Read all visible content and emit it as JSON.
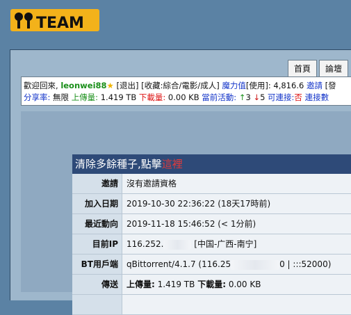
{
  "logo": {
    "text": "MTeam",
    "icon": "mteam-logo"
  },
  "nav": {
    "tabs": [
      "首頁",
      "論壇"
    ]
  },
  "infobar": {
    "welcome": "歡迎回來,",
    "username": "leonwei88",
    "logout": "[退出]",
    "collections": "[收藏:綜合/電影/成人]",
    "magic_label": "魔力值",
    "magic_value": "[使用]: 4,816.6",
    "invite": "邀請",
    "more": "[發",
    "share_label": "分享率:",
    "share_value": "無限",
    "upload_label": "上傳量:",
    "upload_value": "1.419 TB",
    "download_label": "下載量:",
    "download_value": "0.00 KB",
    "active_label": "當前活動:",
    "seeding": "3",
    "leeching": "5",
    "connectable_label": "可連接:",
    "connectable_value": "否",
    "connect_more": "連接數"
  },
  "banner": {
    "text": "清除多餘種子,點擊",
    "link": "這裡"
  },
  "profile": [
    {
      "key": "邀請",
      "value": "沒有邀請資格"
    },
    {
      "key": "加入日期",
      "value": "2019-10-30 22:36:22 (18天17時前)"
    },
    {
      "key": "最近動向",
      "value": "2019-11-18 15:46:52 (< 1分前)"
    },
    {
      "key": "目前IP",
      "value_a": "116.252.",
      "value_b": "[中国-广西-南宁]"
    },
    {
      "key": "BT用戶端",
      "value_a": "qBittorrent/4.1.7 (116.25",
      "value_b": "0 | :::52000)"
    },
    {
      "key": "傳送",
      "upload_label": "上傳量:",
      "upload_value": "1.419 TB",
      "download_label": "下載量:",
      "download_value": "0.00 KB"
    }
  ]
}
